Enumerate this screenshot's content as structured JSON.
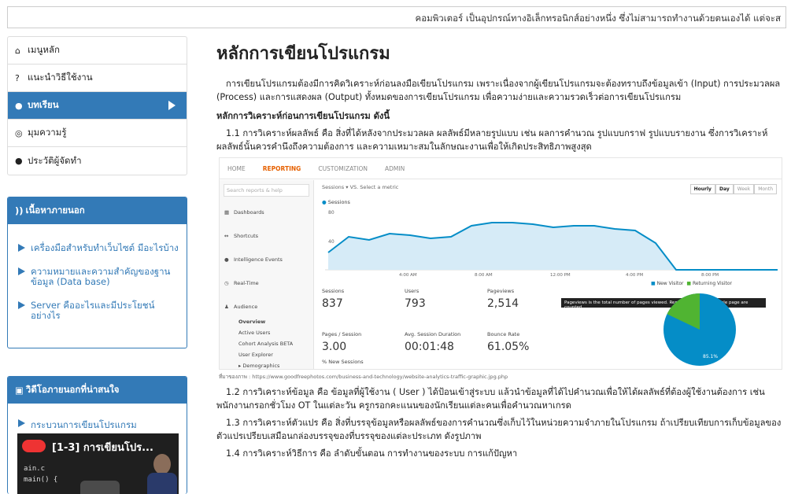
{
  "marquee": {
    "text": "คอมพิวเตอร์ เป็นอุปกรณ์ทางอิเล็กทรอนิกส์อย่างหนึ่ง ซึ่งไม่สามารถทำงานด้วยตนเองได้ แต่จะส"
  },
  "nav": {
    "items": [
      {
        "label": "เมนูหลัก",
        "icon": "home-icon"
      },
      {
        "label": "แนะนำวิธีใช้งาน",
        "icon": "question-circle-icon"
      },
      {
        "label": "บทเรียน",
        "icon": "user-icon"
      },
      {
        "label": "มุมความรู้",
        "icon": "target-icon"
      },
      {
        "label": "ประวัติผู้จัดทำ",
        "icon": "user-icon"
      }
    ]
  },
  "external": {
    "title": "เนื้อหาภายนอก",
    "links": [
      "เครื่องมือสำหรับทำเว็บไซต์ มีอะไรบ้าง",
      "ความหมายและความสำคัญของฐานข้อมูล (Data base)",
      "Server คืออะไรและมีประโยชน์อย่างไร"
    ]
  },
  "videos": {
    "title": "วิดีโอภายนอกที่น่าสนใจ",
    "link": "กระบวนการเขียนโปรแกรม",
    "thumb_title": "[1-3] การเขียนโปร..."
  },
  "main": {
    "title": "หลักการเขียนโปรแกรม",
    "intro": "การเขียนโปรแกรมต้องมีการคิดวิเคราะห์ก่อนลงมือเขียนโปรแกรม เพราะเนื่องจากผู้เขียนโปรแกรมจะต้องทราบถึงข้อมูลเข้า (Input) การประมวลผล (Process) และการแสดงผล (Output) ทั้งหมดของการเขียนโปรแกรม เพื่อความง่ายและความรวดเร็วต่อการเขียนโปรแกรม",
    "subhead": "หลักการวิเคราะห์ก่อนการเขียนโปรแกรม ดังนี้",
    "p1": "1.1 การวิเคราะห์ผลลัพธ์ คือ สิ่งที่ได้หลังจากประมวลผล ผลลัพธ์มีหลายรูปแบบ เช่น ผลการคำนวณ รูปแบบกราฟ รูปแบบรายงาน ซึ่งการวิเคราะห์ผลลัพธ์นั้นควรคำนึงถึงความต้องการ และความเหมาะสมในลักษณะงานเพื่อให้เกิดประสิทธิภาพสูงสุด",
    "caption": "ที่มาของภาพ : https://www.goodfreephotos.com/business-and-technology/website-analytics-traffic-graphic.jpg.php",
    "p2": "1.2 การวิเคราะห์ข้อมูล คือ ข้อมูลที่ผู้ใช้งาน ( User ) ได้ป้อนเข้าสู่ระบบ แล้วนำข้อมูลที่ได้ไปคำนวณเพื่อให้ได้ผลลัพธ์ที่ต้องผู้ใช้งานต้องการ เช่น พนักงานกรอกชั่วโมง OT ในแต่ละวัน ครูกรอกคะแนนของนักเรียนแต่ละคนเพื่อคำนวณหาเกรด",
    "p3": "1.3 การวิเคราะห์ตัวแปร คือ สิ่งที่บรรจุข้อมูลหรือผลลัพธ์ของการคำนวณซึ่งเก็บไว้ในหน่วยความจำภายในโปรแกรม ถ้าเปรียบเทียบการเก็บข้อมูลของตัวแปรเปรียบเสมือนกล่องบรรจุของที่บรรจุของแต่ละประเภท ดังรูปภาพ",
    "p4": "1.4 การวิเคราะห์วิธีการ คือ ลำดับขั้นตอน การทำงานของระบบ การแก้ปัญหา"
  },
  "analytics": {
    "tabs": [
      "HOME",
      "REPORTING",
      "CUSTOMIZATION",
      "ADMIN"
    ],
    "search": "Search reports & help",
    "side": [
      "Dashboards",
      "Shortcuts",
      "Intelligence Events",
      "Real-Time",
      "Audience"
    ],
    "sub": [
      "Overview",
      "Active Users",
      "Cohort Analysis BETA",
      "User Explorer",
      "▸ Demographics"
    ],
    "control": "Sessions ▾  VS.  Select a metric",
    "legend_line": "Sessions",
    "buttons": [
      "Hourly",
      "Day",
      "Week",
      "Month"
    ],
    "y_ticks": [
      "80",
      "40"
    ],
    "x_ticks": [
      "4:00 AM",
      "8:00 AM",
      "12:00 PM",
      "4:00 PM",
      "8:00 PM"
    ],
    "metrics": [
      {
        "label": "Sessions",
        "value": "837"
      },
      {
        "label": "Users",
        "value": "793"
      },
      {
        "label": "Pageviews",
        "value": "2,514"
      },
      {
        "label": "Pages / Session",
        "value": "3.00"
      },
      {
        "label": "Avg. Session Duration",
        "value": "00:01:48"
      },
      {
        "label": "Bounce Rate",
        "value": "61.05%"
      },
      {
        "label": "% New Sessions",
        "value": ""
      }
    ],
    "pie_legend": [
      "New Visitor",
      "Returning Visitor"
    ],
    "pie_label": "85.1%",
    "tooltip": "Pageviews is the total number of pages viewed. Repeated views of a single page are counted.",
    "colors": {
      "line": "#058dc7",
      "new": "#058dc7",
      "returning": "#50b432"
    }
  }
}
